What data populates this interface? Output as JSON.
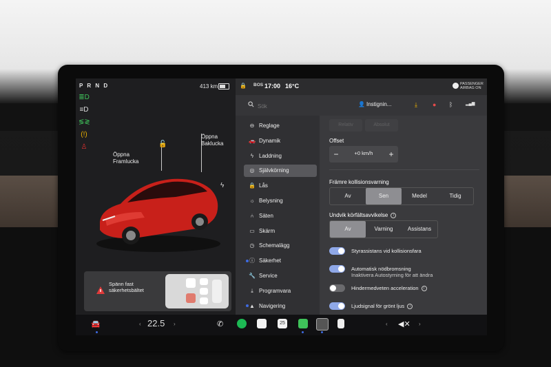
{
  "drive": {
    "gears": "P R N D",
    "range": "413 km"
  },
  "car_labels": {
    "front": "Öppna\nFramlucka",
    "rear": "Öppna\nBaklucka"
  },
  "alert": {
    "text": "Spänn fast säkerhetsbältet"
  },
  "status_bar": {
    "badge": "BOS",
    "time": "17:00",
    "temperature": "16°C",
    "airbag_line1": "PASSENGER",
    "airbag_line2": "AIRBAG ON"
  },
  "search": {
    "placeholder": "Sök"
  },
  "profile": {
    "name": "Instignin..."
  },
  "menu": [
    {
      "label": "Reglage",
      "icon": "toggle-icon"
    },
    {
      "label": "Dynamik",
      "icon": "car-icon"
    },
    {
      "label": "Laddning",
      "icon": "bolt-icon"
    },
    {
      "label": "Självkörning",
      "icon": "steering-wheel-icon",
      "active": true
    },
    {
      "label": "Lås",
      "icon": "lock-icon"
    },
    {
      "label": "Belysning",
      "icon": "sun-icon"
    },
    {
      "label": "Säten",
      "icon": "seat-icon"
    },
    {
      "label": "Skärm",
      "icon": "display-icon"
    },
    {
      "label": "Schemalägg",
      "icon": "clock-icon"
    },
    {
      "label": "Säkerhet",
      "icon": "info-icon",
      "dot": true
    },
    {
      "label": "Service",
      "icon": "wrench-icon"
    },
    {
      "label": "Programvara",
      "icon": "download-icon"
    },
    {
      "label": "Navigering",
      "icon": "nav-icon",
      "dot": true
    }
  ],
  "settings": {
    "faded_tabs": [
      "Relativ",
      "Absolut"
    ],
    "offset": {
      "title": "Offset",
      "value": "+0 km/h",
      "minus": "−",
      "plus": "+"
    },
    "collision": {
      "title": "Främre kollisionsvarning",
      "options": [
        "Av",
        "Sen",
        "Medel",
        "Tidig"
      ],
      "selected": "Sen"
    },
    "lane": {
      "title": "Undvik körfältsavvikelse",
      "options": [
        "Av",
        "Varning",
        "Assistans"
      ],
      "selected": "Av"
    },
    "toggles": [
      {
        "label": "Styrassistans vid kollisionsfara",
        "on": true
      },
      {
        "label": "Automatisk nödbromsning",
        "sub": "Inaktivera Autostyrning för att ändra",
        "on": true
      },
      {
        "label": "Hindermedveten acceleration",
        "on": false,
        "info": true
      },
      {
        "label": "Ljudsignal för grönt ljus",
        "on": true,
        "info": true
      }
    ]
  },
  "dock": {
    "temperature": "22.5",
    "calendar_day": "25"
  },
  "colors": {
    "accent": "#3e6ae1",
    "car": "#c8201a",
    "toggle_on": "#8fa8e8"
  }
}
